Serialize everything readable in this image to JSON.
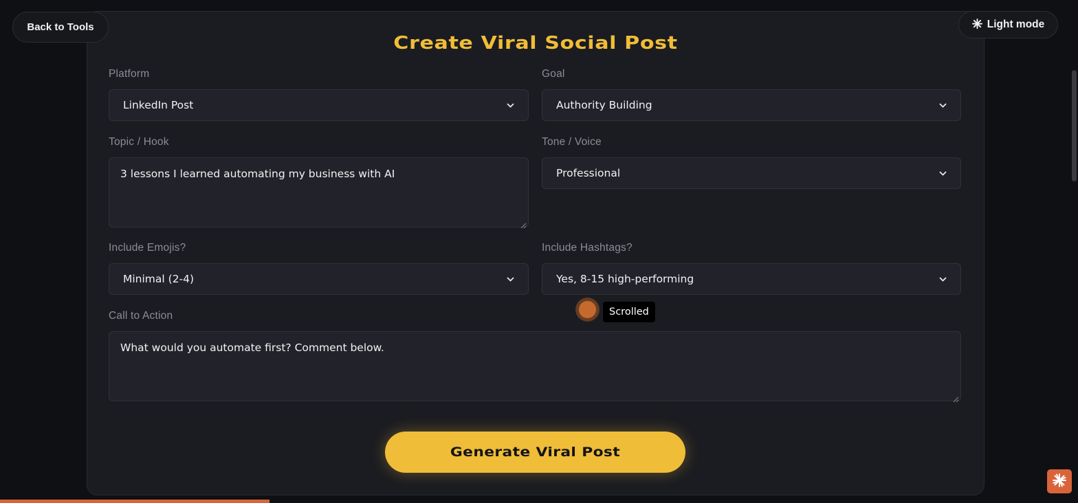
{
  "header": {
    "back_label": "Back to Tools",
    "theme_label": "Light mode",
    "theme_icon": "sun-icon"
  },
  "form": {
    "title": "Create Viral Social Post",
    "platform": {
      "label": "Platform",
      "value": "LinkedIn Post"
    },
    "goal": {
      "label": "Goal",
      "value": "Authority Building"
    },
    "topic": {
      "label": "Topic / Hook",
      "value": "3 lessons I learned automating my business with AI"
    },
    "tone": {
      "label": "Tone / Voice",
      "value": "Professional"
    },
    "emojis": {
      "label": "Include Emojis?",
      "value": "Minimal (2-4)"
    },
    "hashtags": {
      "label": "Include Hashtags?",
      "value": "Yes, 8-15 high-performing"
    },
    "cta": {
      "label": "Call to Action",
      "value": "What would you automate first? Comment below."
    },
    "submit_label": "Generate Viral Post"
  },
  "overlay": {
    "tooltip": "Scrolled"
  },
  "progress": {
    "fraction": 0.25
  },
  "colors": {
    "accent": "#f0bd38",
    "progress": "#d9643a",
    "background": "#0f1013",
    "card": "#1b1c21"
  }
}
